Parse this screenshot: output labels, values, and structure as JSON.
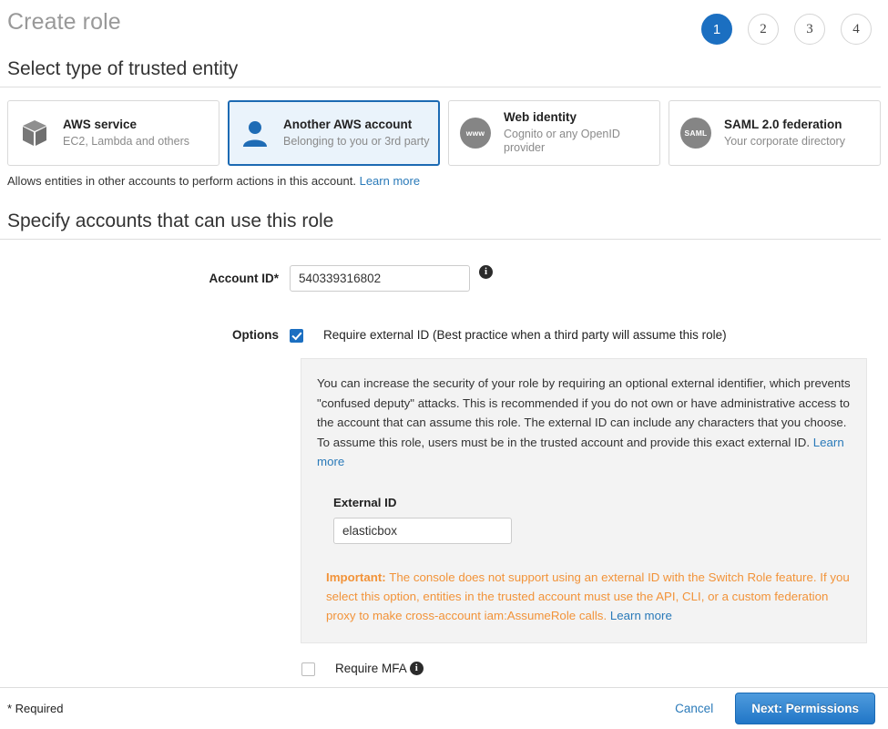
{
  "header": {
    "title": "Create role",
    "steps": [
      {
        "label": "1",
        "active": true
      },
      {
        "label": "2",
        "active": false
      },
      {
        "label": "3",
        "active": false
      },
      {
        "label": "4",
        "active": false
      }
    ]
  },
  "section_trusted_entity": {
    "title": "Select type of trusted entity",
    "cards": [
      {
        "title": "AWS service",
        "subtitle": "EC2, Lambda and others",
        "icon": "cube-icon",
        "selected": false
      },
      {
        "title": "Another AWS account",
        "subtitle": "Belonging to you or 3rd party",
        "icon": "person-icon",
        "selected": true
      },
      {
        "title": "Web identity",
        "subtitle": "Cognito or any OpenID provider",
        "icon": "www-icon",
        "icon_label": "www",
        "selected": false
      },
      {
        "title": "SAML 2.0 federation",
        "subtitle": "Your corporate directory",
        "icon": "saml-icon",
        "icon_label": "SAML",
        "selected": false
      }
    ],
    "helper_text": "Allows entities in other accounts to perform actions in this account.",
    "helper_link": "Learn more"
  },
  "section_accounts": {
    "title": "Specify accounts that can use this role",
    "account_id": {
      "label": "Account ID*",
      "value": "540339316802",
      "placeholder": "",
      "info_icon": "info-icon"
    },
    "options": {
      "label": "Options",
      "require_external_id": {
        "checked": true,
        "label": "Require external ID (Best practice when a third party will assume this role)"
      },
      "require_mfa": {
        "checked": false,
        "label": "Require MFA",
        "info_icon": "info-icon"
      }
    },
    "external_id_panel": {
      "description": "You can increase the security of your role by requiring an optional external identifier, which prevents \"confused deputy\" attacks. This is recommended if you do not own or have administrative access to the account that can assume this role. The external ID can include any characters that you choose. To assume this role, users must be in the trusted account and provide this exact external ID.",
      "description_link": "Learn more",
      "external_id_label": "External ID",
      "external_id_value": "elasticbox",
      "external_id_placeholder": "",
      "warning_prefix": "Important:",
      "warning_text": "The console does not support using an external ID with the Switch Role feature. If you select this option, entities in the trusted account must use the API, CLI, or a custom federation proxy to make cross-account iam:AssumeRole calls.",
      "warning_link": "Learn more"
    }
  },
  "footer": {
    "required_note": "* Required",
    "cancel_label": "Cancel",
    "next_label": "Next: Permissions"
  },
  "colors": {
    "accent_blue": "#1b6fc1",
    "link_blue": "#2a7ab9",
    "warning_orange": "#f29339",
    "selected_card_bg": "#eaf3fb",
    "panel_bg": "#f3f3f3",
    "icon_gray": "#858585"
  }
}
